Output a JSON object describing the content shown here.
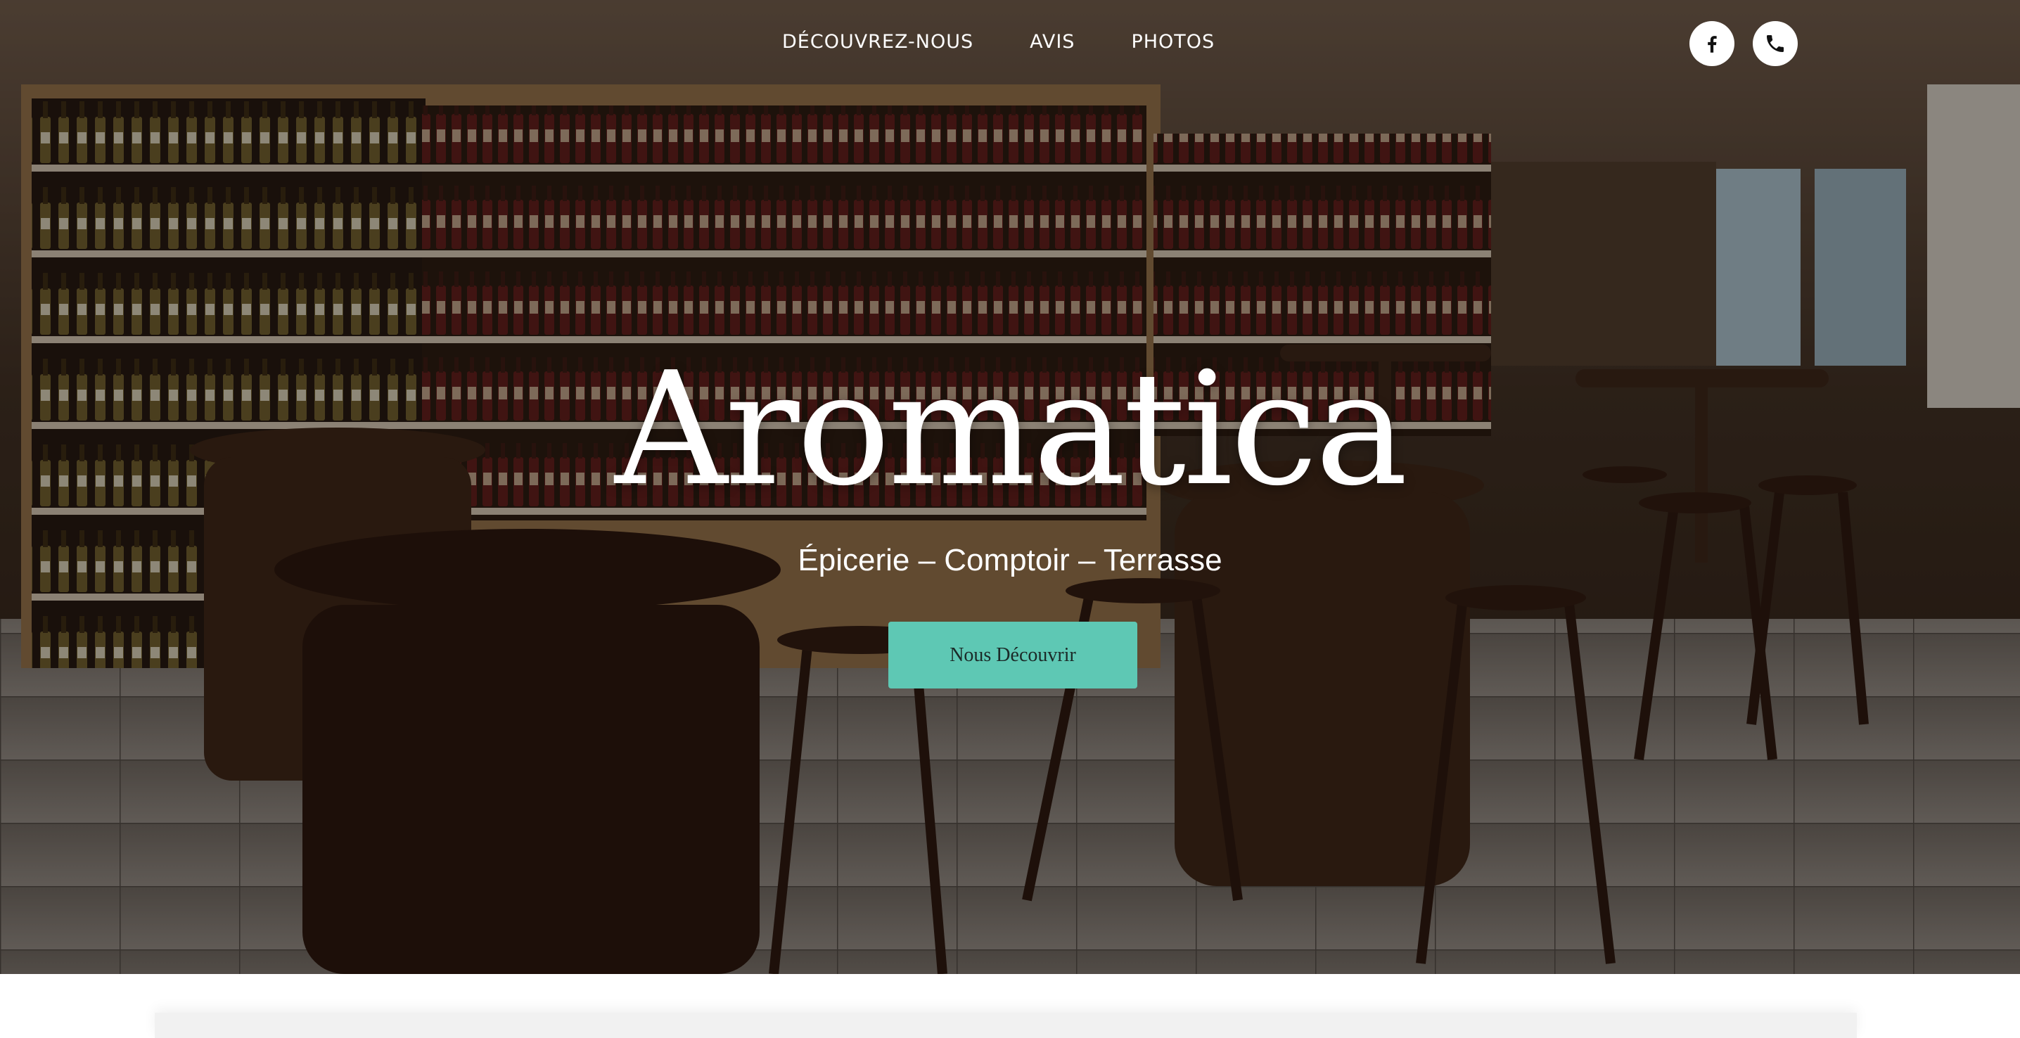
{
  "nav": {
    "links": [
      "DÉCOUVREZ-NOUS",
      "AVIS",
      "PHOTOS"
    ]
  },
  "social": {
    "icons": [
      "facebook-icon",
      "phone-icon"
    ]
  },
  "hero": {
    "title": "Aromatica",
    "subtitle": "Épicerie – Comptoir – Terrasse",
    "cta_label": "Nous Découvrir"
  },
  "colors": {
    "accent": "#5ec8b4",
    "text_light": "#ffffff",
    "page_bg": "#f4f4f4"
  }
}
